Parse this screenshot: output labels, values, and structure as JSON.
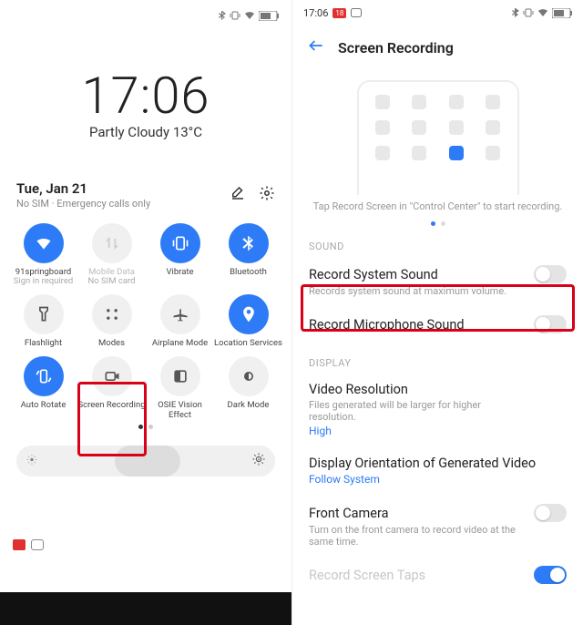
{
  "left": {
    "time": "17:06",
    "weather": "Partly Cloudy 13°C",
    "date": "Tue, Jan 21",
    "sim_status": "No SIM · Emergency calls only",
    "tiles": [
      {
        "label": "91springboard",
        "sub": "Sign in required",
        "state": "on",
        "icon": "wifi-icon"
      },
      {
        "label": "Mobile Data",
        "sub": "No SIM card",
        "state": "disabled",
        "icon": "data-icon"
      },
      {
        "label": "Vibrate",
        "sub": "",
        "state": "on",
        "icon": "vibrate-icon"
      },
      {
        "label": "Bluetooth",
        "sub": "",
        "state": "on",
        "icon": "bluetooth-icon"
      },
      {
        "label": "Flashlight",
        "sub": "",
        "state": "off",
        "icon": "flashlight-icon"
      },
      {
        "label": "Modes",
        "sub": "",
        "state": "off",
        "icon": "modes-icon"
      },
      {
        "label": "Airplane Mode",
        "sub": "",
        "state": "off",
        "icon": "airplane-icon"
      },
      {
        "label": "Location Services",
        "sub": "",
        "state": "on",
        "icon": "location-icon"
      },
      {
        "label": "Auto Rotate",
        "sub": "",
        "state": "on",
        "icon": "rotate-icon"
      },
      {
        "label": "Screen Recording",
        "sub": "",
        "state": "off",
        "icon": "record-icon"
      },
      {
        "label": "OSIE Vision Effect",
        "sub": "",
        "state": "off",
        "icon": "osie-icon"
      },
      {
        "label": "Dark Mode",
        "sub": "",
        "state": "off",
        "icon": "darkmode-icon"
      }
    ]
  },
  "right": {
    "status_time": "17:06",
    "status_badge": "18",
    "header": "Screen Recording",
    "illus_caption": "Tap Record Screen in \"Control Center\" to start recording.",
    "sections": {
      "sound_label": "SOUND",
      "display_label": "DISPLAY"
    },
    "rows": {
      "rec_system": {
        "title": "Record System Sound",
        "desc": "Records system sound at maximum volume.",
        "on": false
      },
      "rec_mic": {
        "title": "Record Microphone Sound",
        "desc": "",
        "on": false
      },
      "video_res": {
        "title": "Video Resolution",
        "desc": "Files generated will be larger for higher resolution.",
        "value": "High"
      },
      "orient": {
        "title": "Display Orientation of Generated Video",
        "value": "Follow System"
      },
      "front_cam": {
        "title": "Front Camera",
        "desc": "Turn on the front camera to record video at the same time.",
        "on": false
      },
      "taps": {
        "title": "Record Screen Taps",
        "on": true
      }
    }
  }
}
